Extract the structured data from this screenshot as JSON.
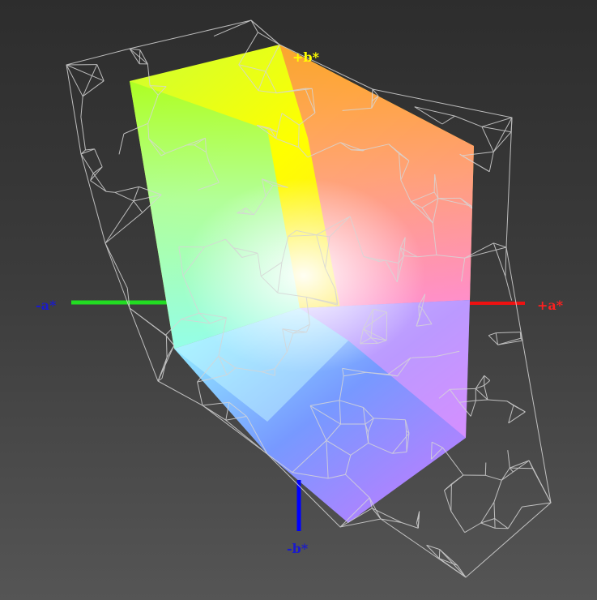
{
  "chart_data": {
    "type": "3d-gamut",
    "axes": [
      {
        "name": "-a*",
        "color": "#1a1acc"
      },
      {
        "name": "+a*",
        "color": "#ff2020"
      },
      {
        "name": "+b*",
        "color": "#ffff00"
      },
      {
        "name": "-b*",
        "color": "#1a1acc"
      }
    ],
    "axis_line_colors": {
      "neg_a": "#22dd22",
      "pos_a": "#ee1111",
      "neg_b": "#0000ff"
    },
    "wireframe_color": "#d6d6d6",
    "solid_gamut_colors": {
      "top": "#ffff00",
      "top_left": "#aaff44",
      "right": "#ff8844",
      "right_low": "#ff66ff",
      "left": "#88ffff",
      "bottom": "#6699ff",
      "bottom_right": "#bb77ff",
      "center": "#ffffff"
    }
  }
}
